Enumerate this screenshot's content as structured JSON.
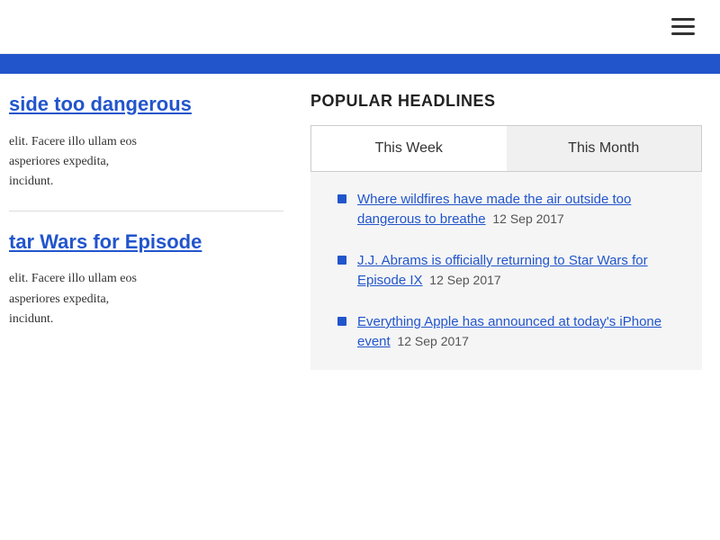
{
  "nav": {
    "hamburger_label": "menu"
  },
  "left_articles": [
    {
      "title": "side too dangerous",
      "body_line1": "elit. Facere illo ullam eos",
      "body_line2": "asperiores expedita,",
      "body_line3": "incidunt."
    },
    {
      "title": "tar Wars for Episode",
      "body_line1": "elit. Facere illo ullam eos",
      "body_line2": "asperiores expedita,",
      "body_line3": "incidunt."
    }
  ],
  "popular_headlines": {
    "section_title": "POPULAR HEADLINES",
    "tabs": [
      {
        "label": "This Week",
        "active": true
      },
      {
        "label": "This Month",
        "active": false
      }
    ],
    "items": [
      {
        "text": "Where wildfires have made the air outside too dangerous to breathe",
        "date": "12 Sep 2017"
      },
      {
        "text": "J.J. Abrams is officially returning to Star Wars for Episode IX",
        "date": "12 Sep 2017"
      },
      {
        "text": "Everything Apple has announced at today's iPhone event",
        "date": "12 Sep 2017"
      }
    ]
  }
}
